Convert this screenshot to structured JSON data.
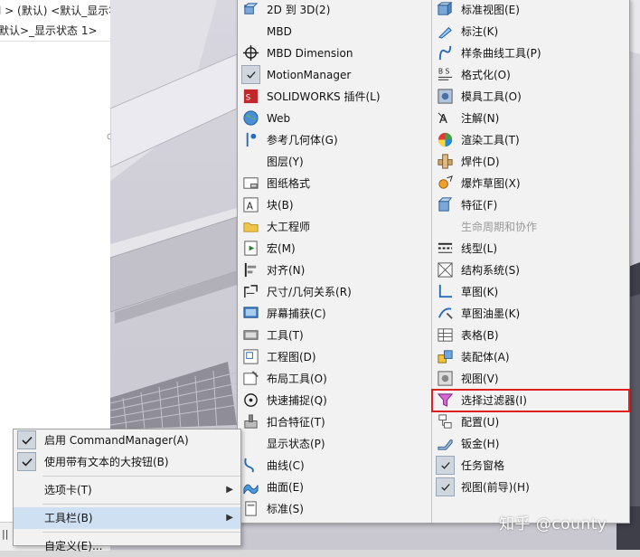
{
  "tree": {
    "row1": "l > (默认) <默认_显示状",
    "row2": "默认>_显示状态 1>"
  },
  "status_bar_fragment": "|| 1",
  "toolbar_menu": {
    "left_items": [
      {
        "label": "2D 到 3D(2)",
        "icon": "2d-to-3d-icon",
        "checked": false
      },
      {
        "label": "MBD",
        "icon": "",
        "checked": false
      },
      {
        "label": "MBD Dimension",
        "icon": "crosshair-icon",
        "checked": false
      },
      {
        "label": "MotionManager",
        "icon": "",
        "checked": true
      },
      {
        "label": "SOLIDWORKS 插件(L)",
        "icon": "addins-icon",
        "checked": false
      },
      {
        "label": "Web",
        "icon": "globe-icon",
        "checked": false
      },
      {
        "label": "参考几何体(G)",
        "icon": "reference-geometry-icon",
        "checked": false
      },
      {
        "label": "图层(Y)",
        "icon": "",
        "checked": false
      },
      {
        "label": "图纸格式",
        "icon": "sheet-format-icon",
        "checked": false
      },
      {
        "label": "块(B)",
        "icon": "block-icon",
        "checked": false
      },
      {
        "label": "大工程师",
        "icon": "folder-icon",
        "checked": false
      },
      {
        "label": "宏(M)",
        "icon": "macro-icon",
        "checked": false
      },
      {
        "label": "对齐(N)",
        "icon": "align-icon",
        "checked": false
      },
      {
        "label": "尺寸/几何关系(R)",
        "icon": "dimension-icon",
        "checked": false
      },
      {
        "label": "屏幕捕获(C)",
        "icon": "screen-capture-icon",
        "checked": false
      },
      {
        "label": "工具(T)",
        "icon": "tools-icon",
        "checked": false
      },
      {
        "label": "工程图(D)",
        "icon": "drawing-icon",
        "checked": false
      },
      {
        "label": "布局工具(O)",
        "icon": "layout-tools-icon",
        "checked": false
      },
      {
        "label": "快速捕捉(Q)",
        "icon": "quick-snap-icon",
        "checked": false
      },
      {
        "label": "扣合特征(T)",
        "icon": "fastening-features-icon",
        "checked": false
      },
      {
        "label": "显示状态(P)",
        "icon": "",
        "checked": false
      },
      {
        "label": "曲线(C)",
        "icon": "curves-icon",
        "checked": false
      },
      {
        "label": "曲面(E)",
        "icon": "surfaces-icon",
        "checked": false
      },
      {
        "label": "标准(S)",
        "icon": "standard-icon",
        "checked": false
      }
    ],
    "right_items": [
      {
        "label": "标准视图(E)",
        "icon": "standard-views-icon",
        "checked": false,
        "disabled": false
      },
      {
        "label": "标注(K)",
        "icon": "annotation-pen-icon",
        "checked": false,
        "disabled": false
      },
      {
        "label": "样条曲线工具(P)",
        "icon": "spline-tools-icon",
        "checked": false,
        "disabled": false
      },
      {
        "label": "格式化(O)",
        "icon": "format-icon",
        "checked": false,
        "disabled": false
      },
      {
        "label": "模具工具(O)",
        "icon": "mold-tools-icon",
        "checked": false,
        "disabled": false
      },
      {
        "label": "注解(N)",
        "icon": "annotations-icon",
        "checked": false,
        "disabled": false
      },
      {
        "label": "渲染工具(T)",
        "icon": "render-tools-icon",
        "checked": false,
        "disabled": false
      },
      {
        "label": "焊件(D)",
        "icon": "weldments-icon",
        "checked": false,
        "disabled": false
      },
      {
        "label": "爆炸草图(X)",
        "icon": "explode-sketch-icon",
        "checked": false,
        "disabled": false
      },
      {
        "label": "特征(F)",
        "icon": "features-icon",
        "checked": false,
        "disabled": false
      },
      {
        "label": "生命周期和协作",
        "icon": "",
        "checked": false,
        "disabled": true
      },
      {
        "label": "线型(L)",
        "icon": "line-format-icon",
        "checked": false,
        "disabled": false
      },
      {
        "label": "结构系统(S)",
        "icon": "structure-system-icon",
        "checked": false,
        "disabled": false
      },
      {
        "label": "草图(K)",
        "icon": "sketch-icon",
        "checked": false,
        "disabled": false
      },
      {
        "label": "草图油墨(K)",
        "icon": "sketch-ink-icon",
        "checked": false,
        "disabled": false
      },
      {
        "label": "表格(B)",
        "icon": "table-icon",
        "checked": false,
        "disabled": false
      },
      {
        "label": "装配体(A)",
        "icon": "assembly-icon",
        "checked": false,
        "disabled": false
      },
      {
        "label": "视图(V)",
        "icon": "view-icon",
        "checked": false,
        "disabled": false
      },
      {
        "label": "选择过滤器(I)",
        "icon": "selection-filter-icon",
        "checked": false,
        "disabled": false,
        "highlighted": true
      },
      {
        "label": "配置(U)",
        "icon": "configurations-icon",
        "checked": false,
        "disabled": false
      },
      {
        "label": "钣金(H)",
        "icon": "sheet-metal-icon",
        "checked": false,
        "disabled": false
      },
      {
        "label": "任务窗格",
        "icon": "",
        "checked": true,
        "disabled": false
      },
      {
        "label": "视图(前导)(H)",
        "icon": "",
        "checked": true,
        "disabled": false
      }
    ]
  },
  "context_menu": {
    "items": [
      {
        "label": "启用 CommandManager(A)",
        "checked": true,
        "submenu": false
      },
      {
        "label": "使用带有文本的大按钮(B)",
        "checked": true,
        "submenu": false
      },
      {
        "label": "选项卡(T)",
        "checked": false,
        "submenu": true
      },
      {
        "label": "工具栏(B)",
        "checked": false,
        "submenu": true,
        "active": true
      },
      {
        "label": "自定义(E)...",
        "checked": false,
        "submenu": false
      }
    ]
  },
  "watermark": "知乎 @county",
  "colors": {
    "highlight_box": "#e02020",
    "menu_bg": "#f2f2f2",
    "active_item": "#cfe0f3"
  }
}
